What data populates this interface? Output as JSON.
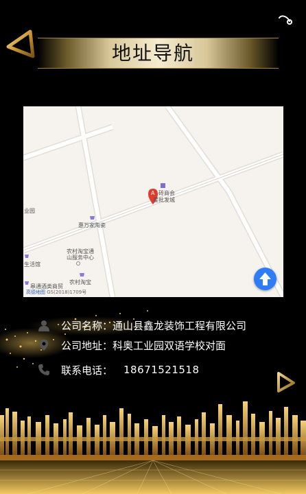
{
  "header": {
    "title": "地址导航",
    "back_icon": "triangle-left-icon",
    "share_icon": "link-icon"
  },
  "map": {
    "labels": {
      "poi_a_line1": "砖商会",
      "poi_a_line2": "翟批发城",
      "marker": "A",
      "industrial_park": "业园",
      "decor_store": "惠万家陶瓷",
      "taobao_line1": "农村淘宝通",
      "taobao_line2": "山服务中心",
      "life_hall": "生活馆",
      "rural_taobao": "农村淘宝",
      "trade_company": "皋通酒类商贸"
    },
    "footer_brand": "高德地图",
    "footer_code": "GS(2018)1709号",
    "locate_icon": "arrow-up-icon"
  },
  "info": {
    "company_name_label": "公司名称：",
    "company_name_value": "通山县鑫龙装饰工程有限公司",
    "company_address_label": "公司地址：",
    "company_address_value": "科奥工业园双语学校对面",
    "phone_label": "联系电话：",
    "phone_value": "18671521518"
  },
  "colors": {
    "gold": "#d4a640",
    "map_bg": "#f6f3ee",
    "locate_blue": "#2e7cf6",
    "marker_red": "#e23b2e"
  }
}
